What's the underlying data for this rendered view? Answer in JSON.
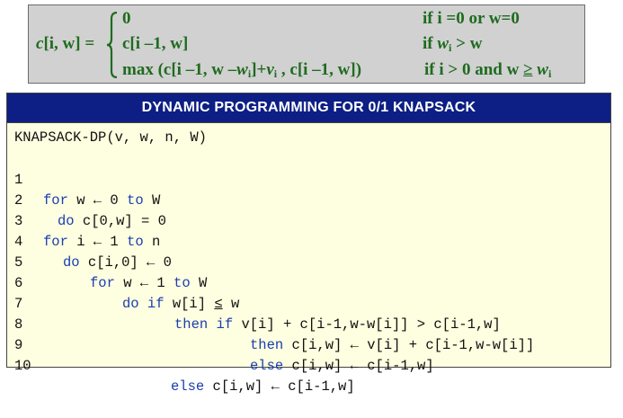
{
  "recurrence": {
    "lhs_c": "c",
    "lhs_args": "[i, w]",
    "lhs_eq": "=",
    "cases": [
      {
        "value": "0",
        "condition": "if  i =0 or  w=0"
      },
      {
        "value": "c[i –1, w]",
        "condition": "if w_i > w"
      },
      {
        "value": "max (c[i –1,  w –w_i]+v_i , c[i –1,  w])",
        "condition": "if i > 0 and w ≥ w_i"
      }
    ]
  },
  "algorithm": {
    "title": "DYNAMIC PROGRAMMING FOR  0/1 KNAPSACK",
    "signature": "KNAPSACK-DP(v, w, n, W)",
    "lines": [
      {
        "num": "1",
        "text": "for w ← 0 to W"
      },
      {
        "num": "2",
        "text": "do c[0,w] = 0"
      },
      {
        "num": "3",
        "text": "for i ← 1 to n"
      },
      {
        "num": "4",
        "text": "do c[i,0] ← 0"
      },
      {
        "num": "5",
        "text": "for w ← 1 to W"
      },
      {
        "num": "6",
        "text": "do if w[i] ≤ w"
      },
      {
        "num": "7",
        "text": "then if v[i] + c[i-1,w-w[i]] > c[i-1,w]"
      },
      {
        "num": "8",
        "text": "then c[i,w] ← v[i] + c[i-1,w-w[i]]"
      },
      {
        "num": "9",
        "text": "else c[i,w] ← c[i-1,w]"
      },
      {
        "num": "10",
        "text": "else c[i,w] ← c[i-1,w]"
      }
    ]
  },
  "colors": {
    "recurrence_text": "#1f6b1f",
    "recurrence_bg": "#d1d1d1",
    "header_bg": "#0d1f84",
    "code_bg": "#fefee0",
    "keyword": "#1a3fb0"
  }
}
